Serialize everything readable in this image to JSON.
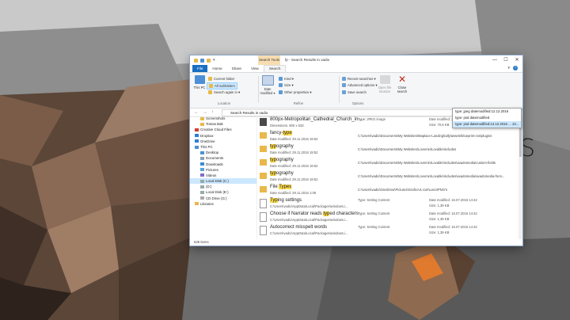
{
  "window": {
    "tab_context": "Search Tools",
    "title": "fp - Search Results in vadio",
    "controls": {
      "minimize": "—",
      "maximize": "☐",
      "close": "✕"
    }
  },
  "tabs": [
    {
      "label": "File"
    },
    {
      "label": "Home"
    },
    {
      "label": "Share"
    },
    {
      "label": "View"
    },
    {
      "label": "Search"
    }
  ],
  "ribbon": {
    "location": {
      "label": "Location",
      "this_pc": "This PC",
      "current_folder": "Current folder",
      "all_subfolders": "All subfolders",
      "search_again": "Search again in ▾"
    },
    "refine": {
      "label": "Refine",
      "date_modified": "Date modified ▾",
      "kind": "Kind ▾",
      "size": "Size ▾",
      "other_properties": "Other properties ▾"
    },
    "options": {
      "label": "Options",
      "recent_searches": "Recent searches ▾",
      "advanced_options": "Advanced options ▾",
      "save_search": "Save search",
      "open_file_location": "Open file location",
      "close_search": "Close search"
    }
  },
  "address": {
    "path": "Search Results in vadio",
    "search_value": "fp"
  },
  "nav_pane": {
    "items": [
      {
        "label": "Screenshots",
        "indent": 1,
        "icon": "folder-icon"
      },
      {
        "label": "Tomas Bak",
        "indent": 1,
        "icon": "folder-icon"
      },
      {
        "label": "Creative Cloud Files",
        "indent": 0,
        "icon": "cloud-icon"
      },
      {
        "label": "Dropbox",
        "indent": 0,
        "icon": "dropbox-icon"
      },
      {
        "label": "OneDrive",
        "indent": 0,
        "icon": "onedrive-icon"
      },
      {
        "label": "This PC",
        "indent": 0,
        "icon": "pc-icon"
      },
      {
        "label": "Desktop",
        "indent": 1,
        "icon": "desktop-icon"
      },
      {
        "label": "Documents",
        "indent": 1,
        "icon": "documents-icon"
      },
      {
        "label": "Downloads",
        "indent": 1,
        "icon": "downloads-icon"
      },
      {
        "label": "Pictures",
        "indent": 1,
        "icon": "pictures-icon"
      },
      {
        "label": "Videos",
        "indent": 1,
        "icon": "videos-icon"
      },
      {
        "label": "Local Disk (C:)",
        "indent": 1,
        "icon": "drive-icon",
        "selected": true
      },
      {
        "label": "(D:)",
        "indent": 1,
        "icon": "drive-icon"
      },
      {
        "label": "Local Disk (E:)",
        "indent": 1,
        "icon": "drive-icon"
      },
      {
        "label": "CD Drive (G:)",
        "indent": 1,
        "icon": "cd-drive-icon"
      },
      {
        "label": "Libraries",
        "indent": 0,
        "icon": "libraries-icon"
      }
    ]
  },
  "status": {
    "items_count": "635 items"
  },
  "results": [
    {
      "name_pre": "800px-Metropolitan_Cathedral_Church_in...",
      "name_hl": "",
      "name_post": "",
      "type_label": "Type: JPEG image",
      "dims": "Dimensions: 800 x 533",
      "date": "Date modified: 27.09.2016 16:56",
      "size": "Size: 70.8 KB",
      "icon": "image-thumbnail-icon",
      "path": ""
    },
    {
      "name_pre": "fancy-",
      "name_hl": "type",
      "name_post": "",
      "sub": "Date modified: 29.11.2016 19:52",
      "path": "C:\\Users\\vadio\\Documents\\My Websites\\Maplace-Landing\\tally\\assets\\blueprint-css\\plugins",
      "icon": "folder-icon"
    },
    {
      "name_pre": "",
      "name_hl": "typ",
      "name_post": "ography",
      "sub": "Date modified: 29.11.2016 19:52",
      "path": "C:\\Users\\vadio\\Documents\\My Websites\\Lovemin\\Lovable\\includes",
      "icon": "folder-icon"
    },
    {
      "name_pre": "",
      "name_hl": "typ",
      "name_post": "ography",
      "sub": "Date modified: 29.11.2016 19:52",
      "path": "C:\\Users\\vadio\\Documents\\My Websites\\Lovemin\\Lovable\\includes\\avadomedia\\custom-fields",
      "icon": "folder-icon"
    },
    {
      "name_pre": "",
      "name_hl": "typ",
      "name_post": "ography",
      "sub": "Date modified: 29.11.2016 19:52",
      "path": "C:\\Users\\vadio\\Documents\\My Websites\\Lovemin\\Lovable\\includes\\avadomedia\\avadomedia-frem...",
      "icon": "folder-icon"
    },
    {
      "name_pre": "File ",
      "name_hl": "Types",
      "name_post": "",
      "sub": "Date modified: 29.11.2016 1:06",
      "path": "C:\\Users\\vadio\\OneDrive\\Pictures\\GraficArt.com\\Leon\\PNG's",
      "icon": "folder-icon"
    },
    {
      "name_pre": "",
      "name_hl": "Typ",
      "name_post": "ing settings",
      "sub": "C:\\Users\\vadio\\AppData\\Local\\Packages\\windows.i...",
      "type_label": "Type: Setting Content",
      "date": "Date modified: 16.07.2016 14:42",
      "size": "Size: 1,39 KB",
      "icon": "document-icon",
      "path": ""
    },
    {
      "name_pre": "Choose if Narrator reads ",
      "name_hl": "typ",
      "name_post": "ed characters",
      "sub": "C:\\Users\\vadio\\AppData\\Local\\Packages\\windows.i...",
      "type_label": "Type: Setting Content",
      "date": "Date modified: 16.07.2016 14:42",
      "size": "Size: 1,39 KB",
      "icon": "document-icon",
      "path": ""
    },
    {
      "name_pre": "Autocorrect misspelt words",
      "name_hl": "",
      "name_post": "",
      "sub": "C:\\Users\\vadio\\AppData\\Local\\Packages\\windows.i...",
      "type_label": "Type: Setting Content",
      "date": "Date modified: 16.07.2016 14:42",
      "size": "Size: 1,39 KB",
      "icon": "document-icon",
      "path": ""
    }
  ],
  "dropdown": [
    "type: jpeg datemodified:12.12.2016",
    "type: psd datemodified",
    "type: psd datemodified:12.12.2016 ... 13..."
  ],
  "background_text": "S",
  "colors": {
    "accent": "#1a6ec1",
    "highlight": "#fddb4b",
    "selection": "#cce8ff",
    "context_tab": "#f7ddb1"
  }
}
